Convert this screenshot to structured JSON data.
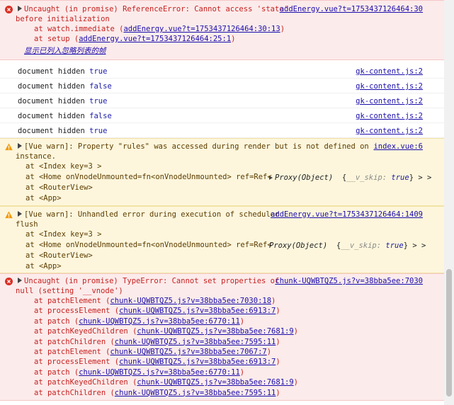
{
  "scrollbar": {
    "label": ""
  },
  "error1": {
    "line1": "Uncaught (in promise) ReferenceError: Cannot access 'state'",
    "line2": "before initialization",
    "source": "addEnergy.vue?t=1753437126464:30",
    "frames": [
      {
        "prefix": "at watch.immediate (",
        "link": "addEnergy.vue?t=1753437126464:30:13",
        "suffix": ")"
      },
      {
        "prefix": "at setup (",
        "link": "addEnergy.vue?t=1753437126464:25:1",
        "suffix": ")"
      }
    ],
    "ignore_list": "显示已列入忽略列表的帧"
  },
  "logs": [
    {
      "text": "document hidden",
      "value": "true",
      "source": "gk-content.js:2"
    },
    {
      "text": "document hidden",
      "value": "false",
      "source": "gk-content.js:2"
    },
    {
      "text": "document hidden",
      "value": "true",
      "source": "gk-content.js:2"
    },
    {
      "text": "document hidden",
      "value": "false",
      "source": "gk-content.js:2"
    },
    {
      "text": "document hidden",
      "value": "true",
      "source": "gk-content.js:2"
    }
  ],
  "warn1": {
    "line1": "[Vue warn]: Property \"rules\" was accessed during render but is not defined on",
    "line2": "instance.",
    "source": "index.vue:6",
    "stack": [
      "at <Index key=3 >",
      "at <Home onVnodeUnmounted=fn<onVnodeUnmounted> ref=Ref<",
      "at <RouterView>",
      "at <App>"
    ],
    "proxy_name": "Proxy(Object)",
    "proxy_open": "{",
    "proxy_key": "__v_skip:",
    "proxy_val": "true",
    "proxy_close": "} > >"
  },
  "warn2": {
    "line1": "[Vue warn]: Unhandled error during execution of scheduler",
    "line2": "flush",
    "source": "addEnergy.vue?t=1753437126464:1409",
    "stack": [
      "at <Index key=3 >",
      "at <Home onVnodeUnmounted=fn<onVnodeUnmounted> ref=Ref<",
      "at <RouterView>",
      "at <App>"
    ],
    "proxy_name": "Proxy(Object)",
    "proxy_open": "{",
    "proxy_key": "__v_skip:",
    "proxy_val": "true",
    "proxy_close": "} > >"
  },
  "error2": {
    "line1": "Uncaught (in promise) TypeError: Cannot set properties of",
    "line2": "null (setting '__vnode')",
    "source": "chunk-UQWBTQZ5.js?v=38bba5ee:7030",
    "frames": [
      {
        "prefix": "at patchElement (",
        "link": "chunk-UQWBTQZ5.js?v=38bba5ee:7030:18",
        "suffix": ")"
      },
      {
        "prefix": "at processElement (",
        "link": "chunk-UQWBTQZ5.js?v=38bba5ee:6913:7",
        "suffix": ")"
      },
      {
        "prefix": "at patch (",
        "link": "chunk-UQWBTQZ5.js?v=38bba5ee:6770:11",
        "suffix": ")"
      },
      {
        "prefix": "at patchKeyedChildren (",
        "link": "chunk-UQWBTQZ5.js?v=38bba5ee:7681:9",
        "suffix": ")"
      },
      {
        "prefix": "at patchChildren (",
        "link": "chunk-UQWBTQZ5.js?v=38bba5ee:7595:11",
        "suffix": ")"
      },
      {
        "prefix": "at patchElement (",
        "link": "chunk-UQWBTQZ5.js?v=38bba5ee:7067:7",
        "suffix": ")"
      },
      {
        "prefix": "at processElement (",
        "link": "chunk-UQWBTQZ5.js?v=38bba5ee:6913:7",
        "suffix": ")"
      },
      {
        "prefix": "at patch (",
        "link": "chunk-UQWBTQZ5.js?v=38bba5ee:6770:11",
        "suffix": ")"
      },
      {
        "prefix": "at patchKeyedChildren (",
        "link": "chunk-UQWBTQZ5.js?v=38bba5ee:7681:9",
        "suffix": ")"
      },
      {
        "prefix": "at patchChildren (",
        "link": "chunk-UQWBTQZ5.js?v=38bba5ee:7595:11",
        "suffix": ")"
      }
    ]
  },
  "colors": {
    "error_bg": "#fcebeb",
    "error_text": "#c5221f",
    "warn_bg": "#fdf6dc",
    "warn_icon": "#f29900",
    "link": "#1a0dab"
  }
}
